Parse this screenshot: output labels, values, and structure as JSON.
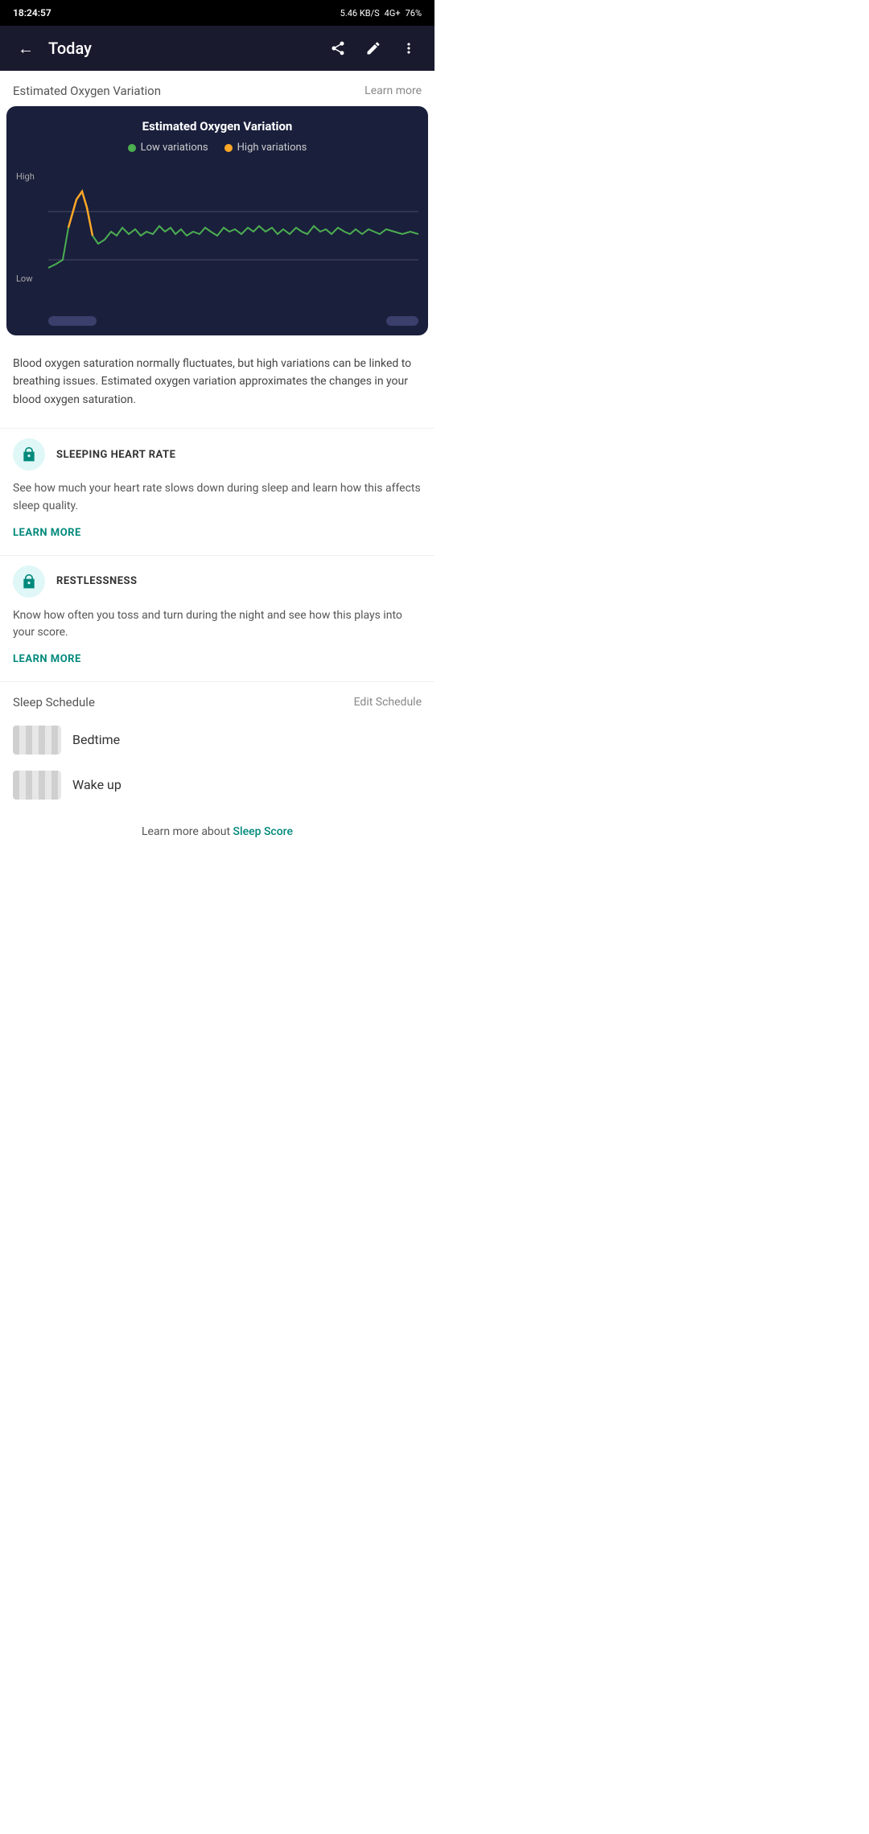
{
  "statusBar": {
    "time": "18:24:57",
    "dataSpeed": "5.46 KB/S",
    "network": "4G+",
    "battery": "76%"
  },
  "toolbar": {
    "title": "Today",
    "backLabel": "←",
    "shareIcon": "share",
    "editIcon": "edit",
    "moreIcon": "more"
  },
  "oxygenSection": {
    "title": "Estimated Oxygen Variation",
    "learnMore": "Learn more",
    "chart": {
      "title": "Estimated Oxygen Variation",
      "legend": [
        {
          "label": "Low variations",
          "color": "#4CAF50"
        },
        {
          "label": "High variations",
          "color": "#FFA726"
        }
      ],
      "yLabels": {
        "high": "High",
        "low": "Low"
      }
    },
    "description": "Blood oxygen saturation normally fluctuates, but high variations can be linked to breathing issues. Estimated oxygen variation approximates the changes in your blood oxygen saturation."
  },
  "sleepingHeartRate": {
    "iconLabel": "🔒",
    "name": "SLEEPING HEART RATE",
    "description": "See how much your heart rate slows down during sleep and learn how this affects sleep quality.",
    "learnMore": "LEARN MORE"
  },
  "restlessness": {
    "iconLabel": "🔒",
    "name": "RESTLESSNESS",
    "description": "Know how often you toss and turn during the night and see how this plays into your score.",
    "learnMore": "LEARN MORE"
  },
  "sleepSchedule": {
    "title": "Sleep Schedule",
    "editLabel": "Edit Schedule",
    "items": [
      {
        "label": "Bedtime"
      },
      {
        "label": "Wake up"
      }
    ]
  },
  "footer": {
    "text": "Learn more about ",
    "linkText": "Sleep Score"
  }
}
